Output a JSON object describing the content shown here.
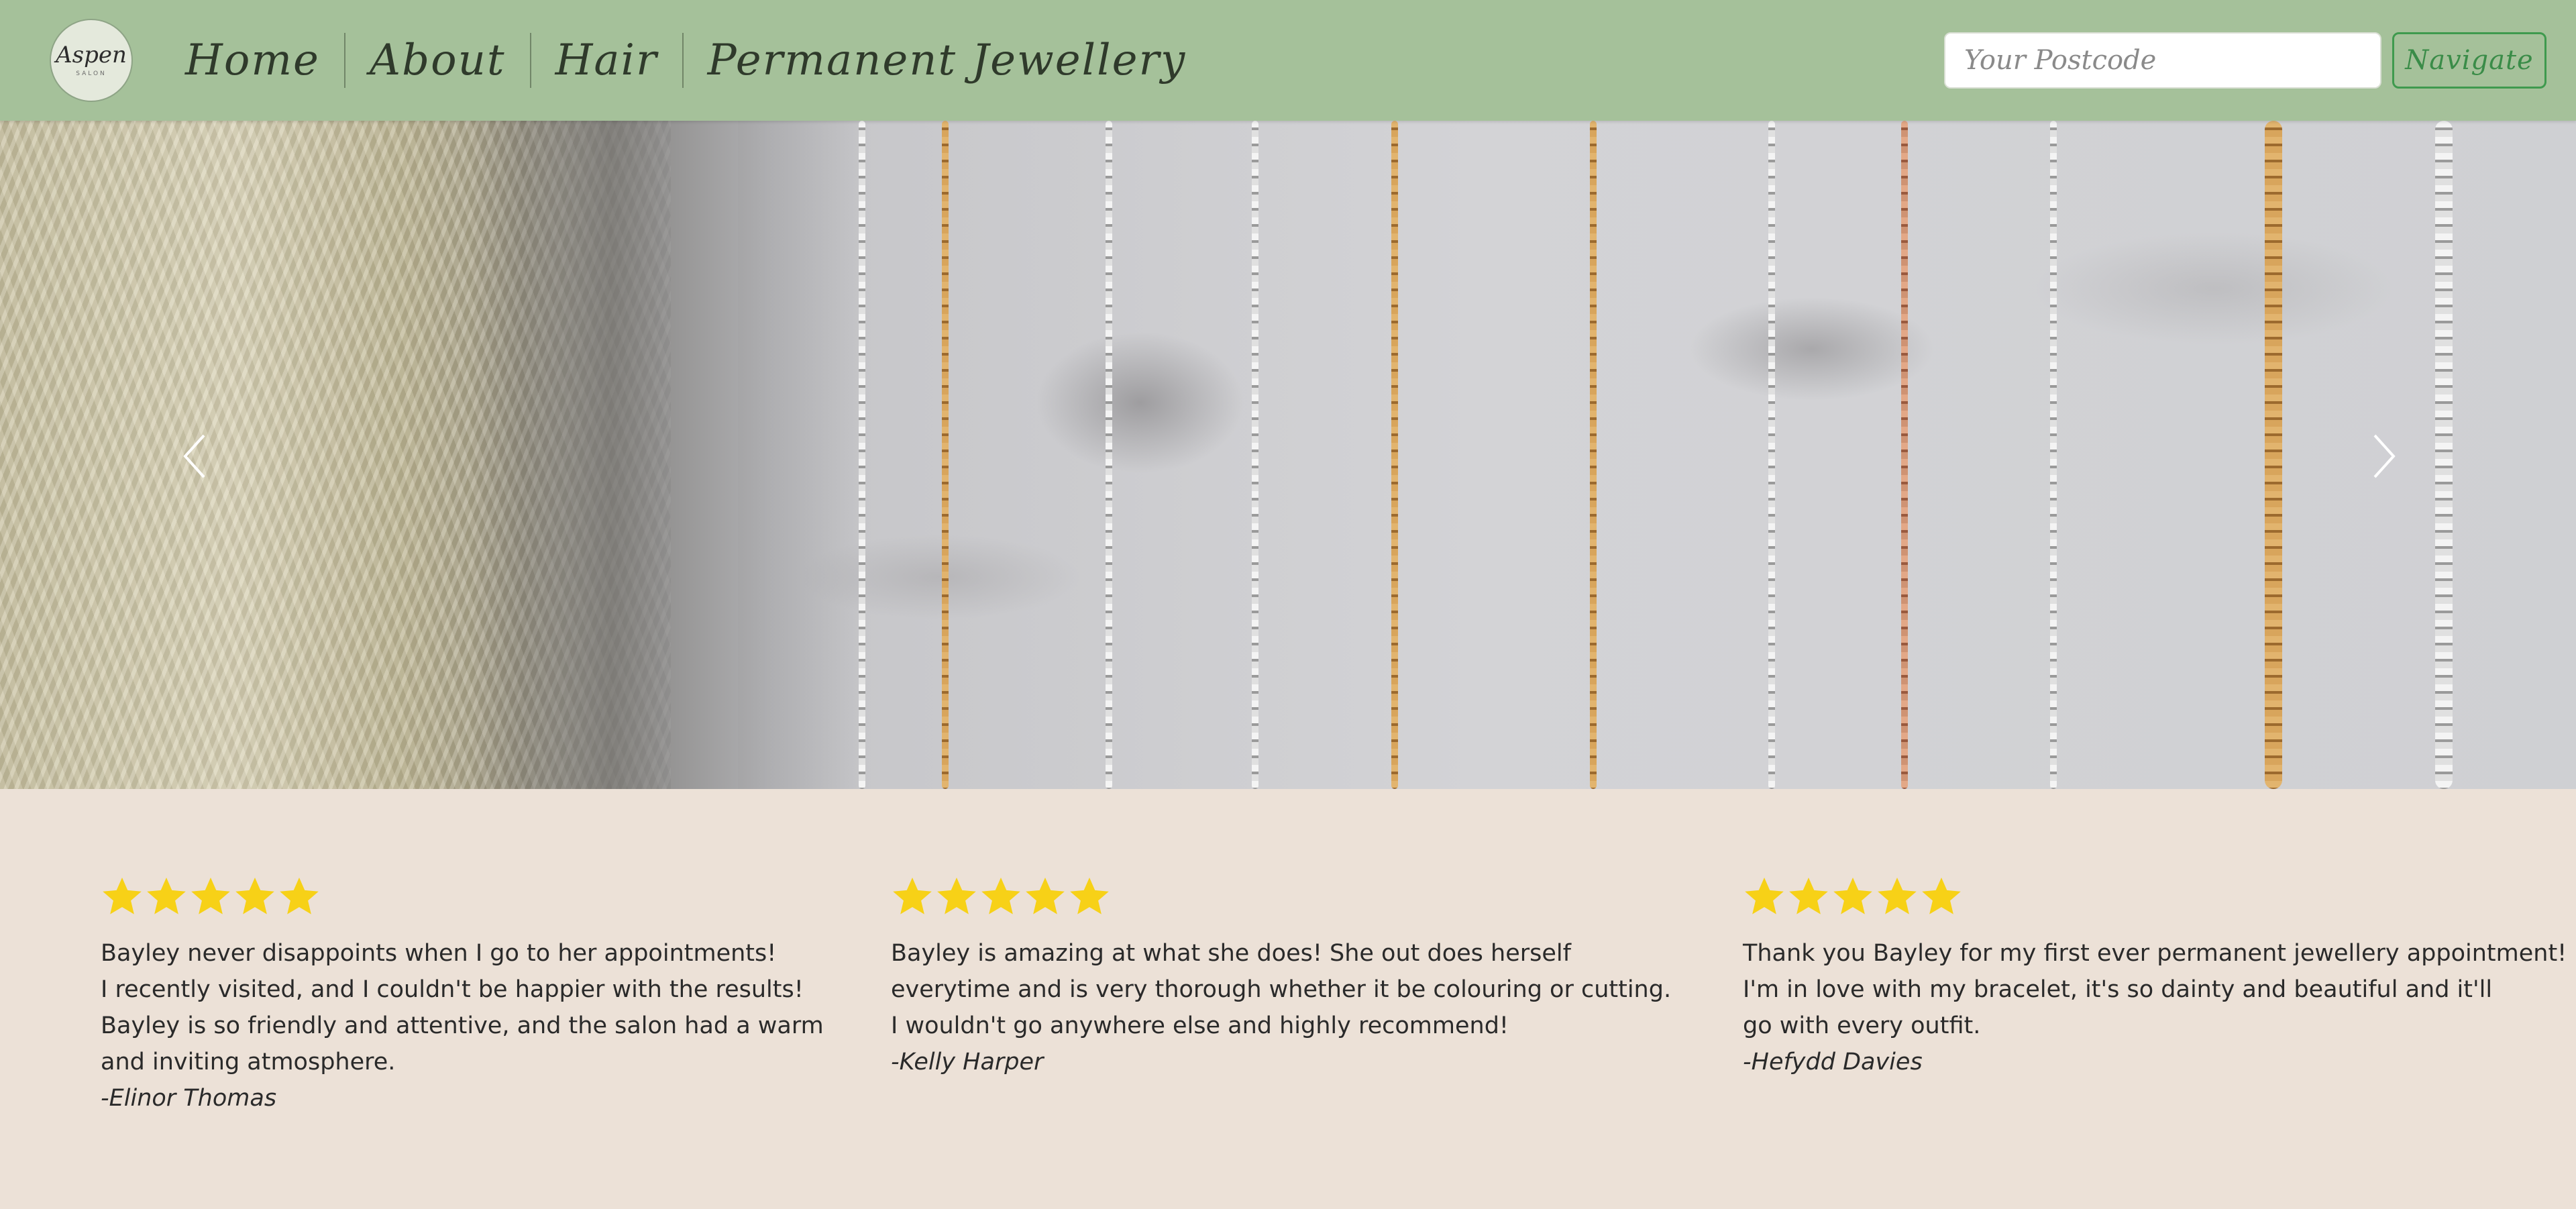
{
  "brand": {
    "logo_text": "Aspen",
    "logo_sub": "SALON"
  },
  "nav": {
    "items": [
      {
        "label": "Home"
      },
      {
        "label": "About"
      },
      {
        "label": "Hair"
      },
      {
        "label": "Permanent Jewellery"
      }
    ],
    "postcode_placeholder": "Your Postcode",
    "navigate_label": "Navigate"
  },
  "carousel": {
    "slide_count": 3,
    "active_slide": 3,
    "prev_icon": "chevron-left-icon",
    "next_icon": "chevron-right-icon"
  },
  "reviews": [
    {
      "rating": 5,
      "lines": [
        "Bayley never disappoints when I go to her appointments!",
        "I recently visited, and I couldn't be happier with the results!",
        "Bayley is so friendly and attentive, and the salon had a warm",
        "and inviting atmosphere."
      ],
      "author": "-Elinor Thomas"
    },
    {
      "rating": 5,
      "lines": [
        "Bayley is amazing at what she does! She out does herself",
        "everytime and is very thorough whether it be colouring or cutting.",
        "I wouldn't go anywhere else and highly recommend!"
      ],
      "author": "-Kelly Harper"
    },
    {
      "rating": 5,
      "lines": [
        "Thank you Bayley for my first ever permanent jewellery appointment!",
        "I'm in love with my bracelet, it's so dainty and beautiful and it'll",
        "go with every outfit."
      ],
      "author": "-Hefydd Davies"
    }
  ],
  "colors": {
    "nav_bg": "#a5c19a",
    "page_bg": "#ece1d7",
    "star": "#f7d117",
    "navigate_border": "#3f9a4e"
  }
}
